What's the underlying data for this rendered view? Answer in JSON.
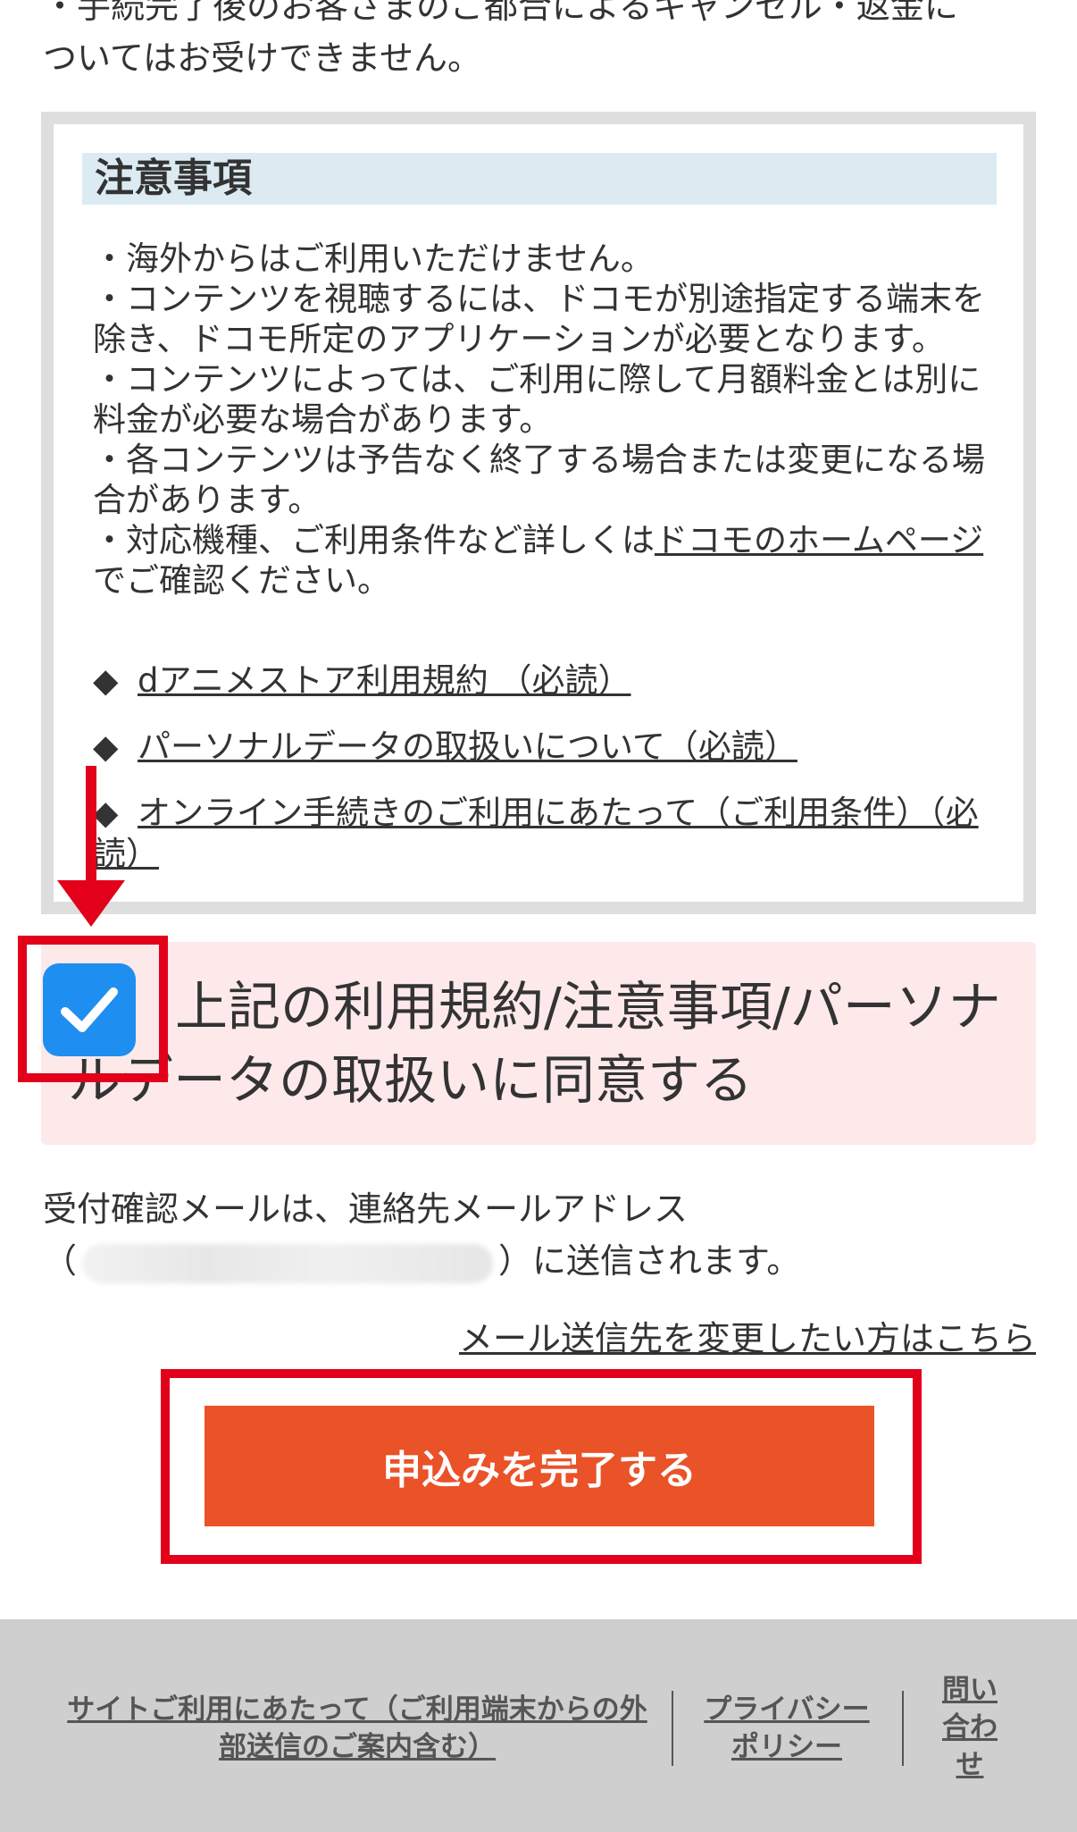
{
  "intro": {
    "line1": "・手続完了後のお客さまのご都合によるキャンセル・返金に",
    "line2": "ついてはお受けできません。"
  },
  "notice": {
    "title": "注意事項",
    "items": [
      "・海外からはご利用いただけません。",
      "・コンテンツを視聴するには、ドコモが別途指定する端末を除き、ドコモ所定のアプリケーションが必要となります。",
      "・コンテンツによっては、ご利用に際して月額料金とは別に料金が必要な場合があります。",
      "・各コンテンツは予告なく終了する場合または変更になる場合があります。"
    ],
    "last_item_prefix": "・対応機種、ご利用条件など詳しくは",
    "last_item_link": "ドコモのホームページ",
    "last_item_suffix": "でご確認ください。"
  },
  "terms": {
    "diamond": "◆",
    "links": [
      "dアニメストア利用規約 （必読）",
      "パーソナルデータの取扱いについて（必読）",
      "オンライン手続きのご利用にあたって（ご利用条件）（必読）"
    ]
  },
  "agreement": {
    "label": "上記の利用規約/注意事項/パーソナルデータの取扱いに同意する",
    "checked": true,
    "checkbox_color": "#1e8ef1"
  },
  "mail": {
    "line1": "受付確認メールは、連絡先メールアドレス",
    "open_paren": "（",
    "close_paren": "）に送信されます。",
    "change_link": "メール送信先を変更したい方はこちら"
  },
  "submit": {
    "label": "申込みを完了する",
    "color": "#ea5228"
  },
  "highlight_color": "#e2001a",
  "footer": {
    "site_link": "サイトご利用にあたって（ご利用端末からの外部送信のご案内含む）",
    "privacy_link": "プライバシーポリシー",
    "contact_link": "問い合わせ"
  }
}
